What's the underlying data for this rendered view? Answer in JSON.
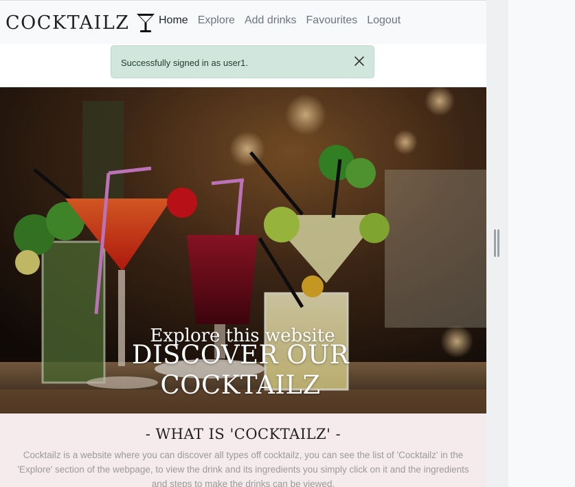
{
  "navbar": {
    "brand": "COCKTAILZ",
    "brand_icon": "cocktail-glass-icon",
    "links": [
      {
        "label": "Home",
        "active": true
      },
      {
        "label": "Explore",
        "active": false
      },
      {
        "label": "Add drinks",
        "active": false
      },
      {
        "label": "Favourites",
        "active": false
      },
      {
        "label": "Logout",
        "active": false
      }
    ]
  },
  "alert": {
    "message": "Successfully signed in as user1.",
    "close_icon": "close-icon",
    "color": "#d1e7dd"
  },
  "hero": {
    "title_line1": "DISCOVER OUR",
    "title_line2": "COCKTAILZ",
    "subtitle": "Explore this website"
  },
  "about": {
    "heading": "- WHAT IS 'COCKTAILZ' -",
    "text": "Cocktailz is a website where you can discover all types off cocktailz, you can see the list of 'Cocktailz' in the 'Explore' section of the webpage, to view the drink and its ingredients you simply click on it and the ingredients and steps to make the drinks can be viewed.",
    "background": "#f5ebec"
  }
}
